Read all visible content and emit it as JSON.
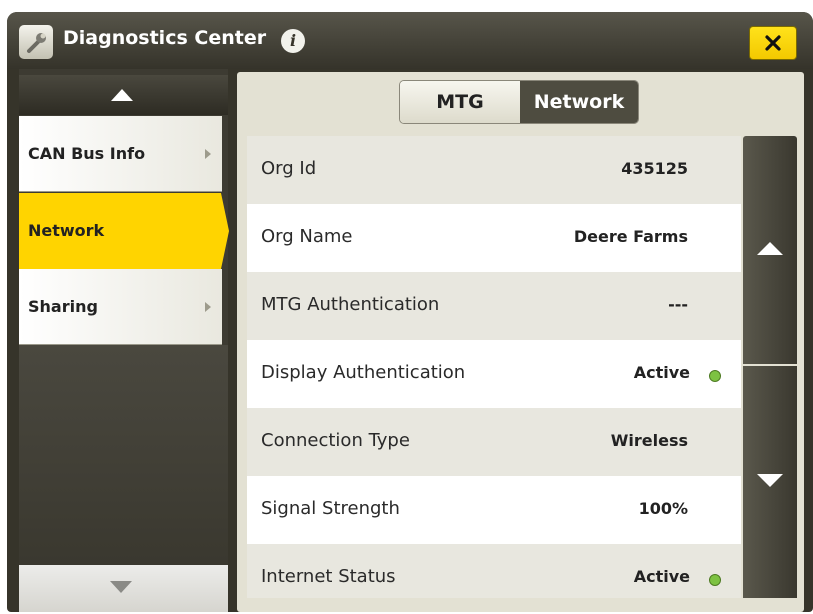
{
  "window": {
    "title": "Diagnostics Center",
    "app_icon": "wrench-icon",
    "info_icon": "info-icon",
    "close_icon": "close-icon"
  },
  "sidebar": {
    "items": [
      {
        "label": "CAN Bus Info",
        "active": false
      },
      {
        "label": "Network",
        "active": true
      },
      {
        "label": "Sharing",
        "active": false
      }
    ]
  },
  "tabs": [
    {
      "label": "MTG",
      "selected": false
    },
    {
      "label": "Network",
      "selected": true
    }
  ],
  "rows": [
    {
      "label": "Org Id",
      "value": "435125"
    },
    {
      "label": "Org Name",
      "value": "Deere Farms"
    },
    {
      "label": "MTG Authentication",
      "value": "---"
    },
    {
      "label": "Display Authentication",
      "value": "Active",
      "status": "green"
    },
    {
      "label": "Connection Type",
      "value": "Wireless"
    },
    {
      "label": "Signal Strength",
      "value": "100%"
    },
    {
      "label": "Internet Status",
      "value": "Active",
      "status": "green"
    }
  ],
  "colors": {
    "accent": "#ffd400",
    "status_ok": "#7dc242",
    "dark": "#36342a"
  }
}
